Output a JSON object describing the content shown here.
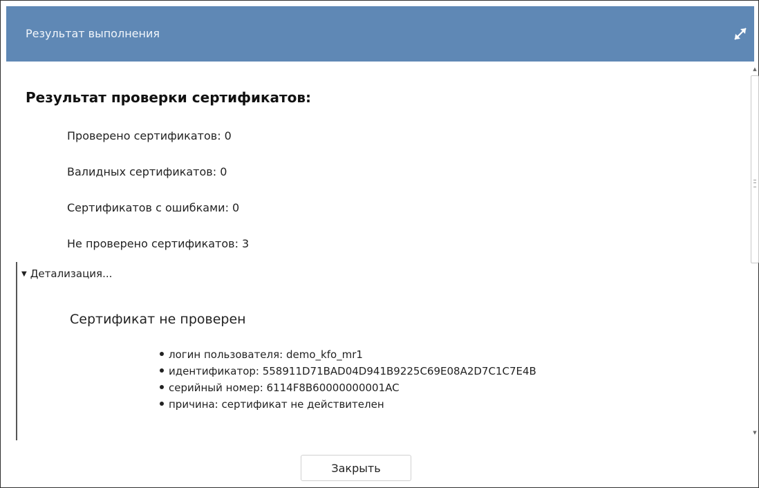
{
  "dialog": {
    "title": "Результат выполнения"
  },
  "result": {
    "heading": "Результат проверки сертификатов:",
    "stats": [
      "Проверено сертификатов: 0",
      "Валидных сертификатов: 0",
      "Сертификатов с ошибками: 0",
      "Не проверено сертификатов: 3"
    ],
    "details_label": "Детализация...",
    "certificate": {
      "title": "Сертификат не проверен",
      "fields": [
        "логин пользователя: demo_kfo_mr1",
        "идентификатор: 558911D71BAD04D941B9225C69E08A2D7C1C7E4B",
        "серийный номер: 6114F8B60000000001AC",
        "причина: сертификат не действителен"
      ]
    }
  },
  "footer": {
    "close_label": "Закрыть"
  },
  "colors": {
    "titlebar": "#5f88b5",
    "title_text": "#f2f6fb"
  },
  "icons": {
    "expand": "expand-icon",
    "details_toggle": "triangle-down-icon"
  }
}
